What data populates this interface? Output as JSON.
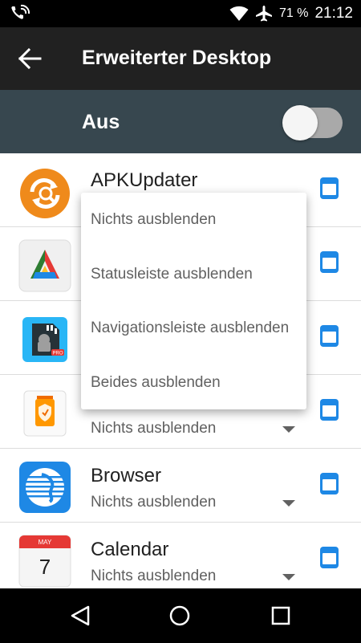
{
  "status_bar": {
    "battery_percent": "71 %",
    "time": "21:12"
  },
  "app_bar": {
    "title": "Erweiterter Desktop"
  },
  "master_switch": {
    "label": "Aus",
    "on": false
  },
  "apps": [
    {
      "name": "APKUpdater",
      "mode": ""
    },
    {
      "name": "",
      "mode": ""
    },
    {
      "name": "",
      "mode": ""
    },
    {
      "name": "",
      "mode": "Nichts ausblenden"
    },
    {
      "name": "Browser",
      "mode": "Nichts ausblenden"
    },
    {
      "name": "Calendar",
      "mode": "Nichts ausblenden",
      "icon_month": "MAY",
      "icon_day": "7"
    }
  ],
  "dropdown_options": [
    "Nichts ausblenden",
    "Statusleiste ausblenden",
    "Navigationsleiste ausblenden",
    "Beides ausblenden"
  ],
  "colors": {
    "accent": "#1e88e5",
    "app_bar": "#212121",
    "switch_bar": "#37474f"
  }
}
